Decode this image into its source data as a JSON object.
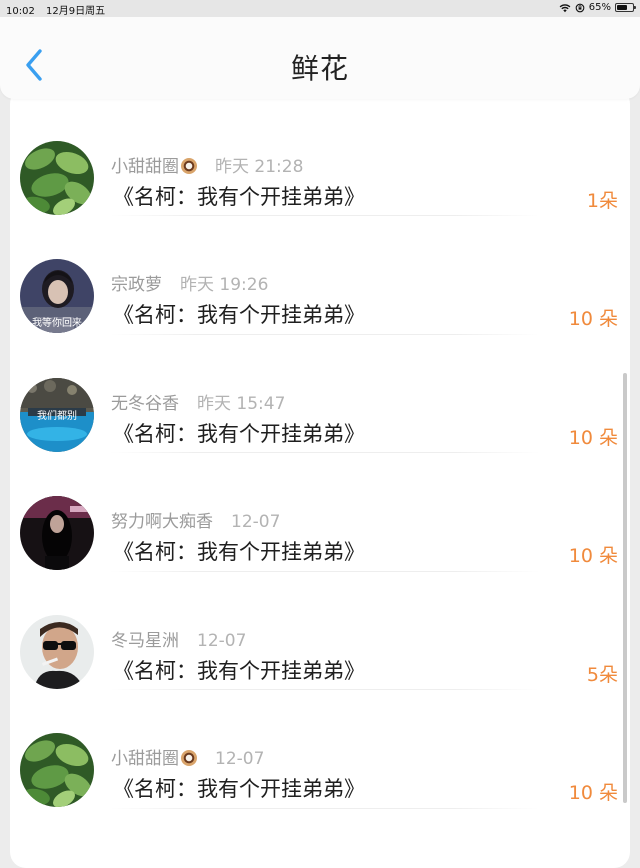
{
  "status": {
    "time": "10:02",
    "date": "12月9日周五",
    "battery": "65%",
    "battery_level": 0.65,
    "icons": [
      "wifi-icon",
      "orientation-lock-icon",
      "battery-icon"
    ]
  },
  "nav": {
    "title": "鲜花",
    "back_icon": "chevron-left-icon",
    "accent": "#3a9ff0"
  },
  "accent_count_color": "#f08a3c",
  "items": [
    {
      "name": "",
      "time": "",
      "book": "《名柯：我有个开挂弟弟》",
      "count": "",
      "avatar": "plant-leaves",
      "partial": true
    },
    {
      "name": "小甜甜圈",
      "time": "昨天 21:28",
      "book": "《名柯：我有个开挂弟弟》",
      "count": "1朵",
      "avatar": "plant-leaves",
      "emoji": "doughnut"
    },
    {
      "name": "宗政萝",
      "time": "昨天 19:26",
      "book": "《名柯：我有个开挂弟弟》",
      "count": "10 朵",
      "avatar": "girl-portrait",
      "avatar_text": "我等你回来"
    },
    {
      "name": "无冬谷香",
      "time": "昨天 15:47",
      "book": "《名柯：我有个开挂弟弟》",
      "count": "10 朵",
      "avatar": "blue-water",
      "avatar_text": "我们都别"
    },
    {
      "name": "努力啊大痴香",
      "time": "12-07",
      "book": "《名柯：我有个开挂弟弟》",
      "count": "10 朵",
      "avatar": "dark-hair-girl"
    },
    {
      "name": "冬马星洲",
      "time": "12-07",
      "book": "《名柯：我有个开挂弟弟》",
      "count": "5朵",
      "avatar": "man-sunglasses"
    },
    {
      "name": "小甜甜圈",
      "time": "12-07",
      "book": "《名柯：我有个开挂弟弟》",
      "count": "10 朵",
      "avatar": "plant-leaves",
      "emoji": "doughnut"
    }
  ]
}
